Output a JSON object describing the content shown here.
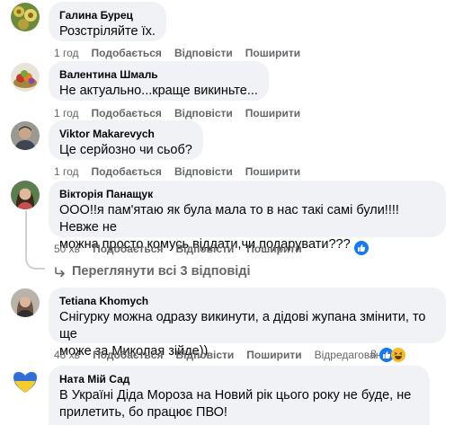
{
  "colors": {
    "bubble": "#f0f2f5",
    "meta_text": "#65676b",
    "like_blue": "#1877f2",
    "haha_yellow": "#f7b928"
  },
  "actions_labels": {
    "like": "Подобається",
    "reply": "Відповісти",
    "share": "Поширити"
  },
  "comments": [
    {
      "author": "Галина Бурец",
      "text": "Розстріляйте їх.",
      "time": "1 год",
      "avatar": "avatar-flowers"
    },
    {
      "author": "Валентина Шмаль",
      "text": "Не актуально...краще викиньте...",
      "time": "1 год",
      "avatar": "avatar-fruit"
    },
    {
      "author": "Viktor Makarevych",
      "text": "Це серйозно чи сьоб?",
      "time": "1 год",
      "avatar": "avatar-man"
    },
    {
      "author": "Вікторія Панащук",
      "text_lines": [
        "ООО!!я пам'ятаю як була мала то в нас такі самі були!!!!Невже не",
        "можна просто комусь віддати,чи подарувати???"
      ],
      "time": "50 хв",
      "avatar": "avatar-woman",
      "reaction_icon": "like-icon",
      "view_replies": "Переглянути всі 3 відповіді"
    },
    {
      "author": "Tetiana Khomych",
      "text_lines": [
        "Снігурку можна одразу викинути, а дідові жупана змінити, то ще",
        "може за Миколая зійде))"
      ],
      "time": "48 хв",
      "edited": "Відредаговано",
      "reaction_count": "8",
      "reaction_icons": [
        "like-icon",
        "haha-icon"
      ]
    },
    {
      "author": "Ната Мій Сад",
      "text_lines": [
        "В Україні Діда Мороза на Новий рік цього року не буде, не",
        "прилетить, бо працює ПВО!"
      ],
      "avatar": "avatar-ukraine-heart"
    }
  ]
}
